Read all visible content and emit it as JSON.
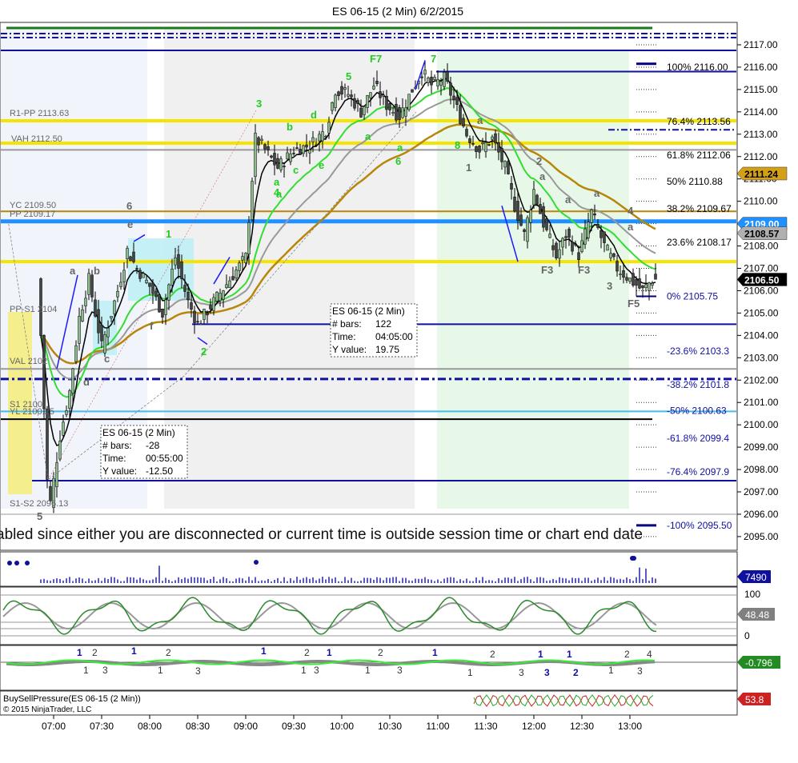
{
  "title": "ES 06-15 (2 Min)  6/2/2015",
  "price_axis_ticks": [
    "2117.00",
    "2116.00",
    "2115.00",
    "2114.00",
    "2113.00",
    "2112.00",
    "2111.00",
    "2110.00",
    "2109.00",
    "2108.00",
    "2107.00",
    "2106.00",
    "2105.00",
    "2104.00",
    "2103.00",
    "2102.00",
    "2101.00",
    "2100.00",
    "2099.00",
    "2098.00",
    "2097.00",
    "2096.00",
    "2095.00"
  ],
  "time_axis_ticks": [
    "07:00",
    "07:30",
    "08:00",
    "08:30",
    "09:00",
    "09:30",
    "10:00",
    "10:30",
    "11:00",
    "11:30",
    "12:00",
    "12:30",
    "13:00"
  ],
  "pivot_labels": {
    "r1pp": "R1-PP 2113.63",
    "vah": "VAH 2112.50",
    "yc": "YC 2109.50",
    "pp": "PP 2109.17",
    "pps1": "PP-S1 2104",
    "val": "VAL 2102",
    "s1": "S1 2100",
    "yl": "YL 2100.25",
    "s1s2": "S1-S2 2096.13"
  },
  "fib_labels": [
    {
      "text": "100%  2116.00",
      "price": 2116.0
    },
    {
      "text": "76.4%  2113.56",
      "price": 2113.56
    },
    {
      "text": "61.8%  2112.06",
      "price": 2112.06
    },
    {
      "text": "50%  2110.88",
      "price": 2110.88
    },
    {
      "text": "38.2%  2109.67",
      "price": 2109.67
    },
    {
      "text": "23.6%  2108.17",
      "price": 2108.17
    },
    {
      "text": "0%  2105.75",
      "price": 2105.75
    },
    {
      "text": "-23.6%  2103.3",
      "price": 2103.3
    },
    {
      "text": "-38.2%  2101.8",
      "price": 2101.8
    },
    {
      "text": "-50%  2100.63",
      "price": 2100.63
    },
    {
      "text": "-61.8%  2099.4",
      "price": 2099.4
    },
    {
      "text": "-76.4%  2097.9",
      "price": 2097.9
    },
    {
      "text": "-100%  2095.50",
      "price": 2095.5
    }
  ],
  "price_badges": [
    {
      "text": "2111.24",
      "price": 2111.24,
      "bg": "#d4a017",
      "fg": "#000000"
    },
    {
      "text": "2109.00",
      "price": 2109.0,
      "bg": "#1e90ff",
      "fg": "#ffffff"
    },
    {
      "text": "2108.57",
      "price": 2108.57,
      "bg": "#b0b0b0",
      "fg": "#000000"
    },
    {
      "text": "2106.50",
      "price": 2106.5,
      "bg": "#000000",
      "fg": "#ffffff"
    }
  ],
  "info_boxes": [
    {
      "title": "ES 06-15 (2 Min)",
      "rows": [
        [
          "# bars:",
          "122"
        ],
        [
          "Time:",
          "04:05:00"
        ],
        [
          "Y value:",
          "19.75"
        ]
      ]
    },
    {
      "title": "ES 06-15 (2 Min)",
      "rows": [
        [
          "# bars:",
          "-28"
        ],
        [
          "Time:",
          "00:55:00"
        ],
        [
          "Y value:",
          "-12.50"
        ]
      ]
    }
  ],
  "banner_text": "abled since either you are disconnected or current time is outside session time or chart end date",
  "wave_labels": [
    {
      "t": "F7",
      "color": "#22cc22"
    },
    {
      "t": "7",
      "color": "#22cc22"
    },
    {
      "t": "5",
      "color": "#22cc22"
    },
    {
      "t": "3",
      "color": "#22cc22"
    },
    {
      "t": "1",
      "color": "#22cc22"
    },
    {
      "t": "2",
      "color": "#22cc22"
    },
    {
      "t": "6",
      "color": "#22cc22"
    },
    {
      "t": "8",
      "color": "#22cc22"
    },
    {
      "t": "a",
      "color": "#22cc22"
    },
    {
      "t": "b",
      "color": "#22cc22"
    },
    {
      "t": "c",
      "color": "#22cc22"
    },
    {
      "t": "d",
      "color": "#22cc22"
    },
    {
      "t": "e",
      "color": "#22cc22"
    },
    {
      "t": "a",
      "color": "#22cc22"
    },
    {
      "t": "a",
      "color": "#22cc22"
    },
    {
      "t": "a",
      "color": "#22cc22"
    },
    {
      "t": "4",
      "color": "#22cc22"
    },
    {
      "t": "6",
      "color": "#666666"
    },
    {
      "t": "a",
      "color": "#666666"
    },
    {
      "t": "b",
      "color": "#666666"
    },
    {
      "t": "c",
      "color": "#666666"
    },
    {
      "t": "d",
      "color": "#666666"
    },
    {
      "t": "e",
      "color": "#666666"
    },
    {
      "t": "f",
      "color": "#666666"
    },
    {
      "t": "5",
      "color": "#666666"
    },
    {
      "t": "2",
      "color": "#666666"
    },
    {
      "t": "a",
      "color": "#666666"
    },
    {
      "t": "a",
      "color": "#666666"
    },
    {
      "t": "a",
      "color": "#666666"
    },
    {
      "t": "a",
      "color": "#666666"
    },
    {
      "t": "a",
      "color": "#666666"
    },
    {
      "t": "F3",
      "color": "#666666"
    },
    {
      "t": "F3",
      "color": "#666666"
    },
    {
      "t": "3",
      "color": "#666666"
    },
    {
      "t": "F5",
      "color": "#666666"
    },
    {
      "t": "4",
      "color": "#666666"
    },
    {
      "t": "1",
      "color": "#666666"
    }
  ],
  "volume_badge": {
    "text": "7490",
    "bg": "#1010a0",
    "fg": "#ffffff"
  },
  "stoch_axis": [
    "100",
    "0"
  ],
  "stoch_badge": {
    "text": "48.48",
    "bg": "#808080",
    "fg": "#ffffff"
  },
  "macd_badge": {
    "text": "-0.796",
    "bg": "#228b22",
    "fg": "#ffffff"
  },
  "macd_labels": [
    {
      "t": "1",
      "color": "#1010a0"
    },
    {
      "t": "2",
      "color": "#333333"
    },
    {
      "t": "1",
      "color": "#333333"
    },
    {
      "t": "3",
      "color": "#333333"
    },
    {
      "t": "1",
      "color": "#1010a0"
    },
    {
      "t": "2",
      "color": "#333333"
    },
    {
      "t": "1",
      "color": "#333333"
    },
    {
      "t": "3",
      "color": "#333333"
    },
    {
      "t": "1",
      "color": "#1010a0"
    },
    {
      "t": "2",
      "color": "#333333"
    },
    {
      "t": "1",
      "color": "#333333"
    },
    {
      "t": "3",
      "color": "#333333"
    },
    {
      "t": "1",
      "color": "#1010a0"
    },
    {
      "t": "2",
      "color": "#333333"
    },
    {
      "t": "1",
      "color": "#333333"
    },
    {
      "t": "3",
      "color": "#333333"
    },
    {
      "t": "1",
      "color": "#1010a0"
    },
    {
      "t": "2",
      "color": "#333333"
    },
    {
      "t": "1",
      "color": "#333333"
    },
    {
      "t": "3",
      "color": "#333333"
    },
    {
      "t": "1",
      "color": "#1010a0"
    },
    {
      "t": "1",
      "color": "#1010a0"
    },
    {
      "t": "3",
      "color": "#1010a0"
    },
    {
      "t": "2",
      "color": "#1010a0"
    },
    {
      "t": "1",
      "color": "#333333"
    },
    {
      "t": "2",
      "color": "#333333"
    },
    {
      "t": "3",
      "color": "#333333"
    },
    {
      "t": "4",
      "color": "#333333"
    }
  ],
  "pressure_label": "BuySellPressure(ES 06-15 (2 Min))",
  "copyright": "© 2015 NinjaTrader, LLC",
  "pressure_badge": {
    "text": "53.8",
    "bg": "#cc2222",
    "fg": "#ffffff"
  },
  "chart_data": {
    "type": "candlestick",
    "title": "ES 06-15 (2 Min)  6/2/2015",
    "ylim": [
      2094.5,
      2117.7
    ],
    "x_range": [
      "06:45",
      "13:20"
    ],
    "ohlc_path": [
      [
        "06:52",
        2104.0
      ],
      [
        "06:56",
        2097.5
      ],
      [
        "06:58",
        2096.5
      ],
      [
        "07:04",
        2099.5
      ],
      [
        "07:10",
        2101.5
      ],
      [
        "07:16",
        2104.8
      ],
      [
        "07:22",
        2106.5
      ],
      [
        "07:30",
        2103.5
      ],
      [
        "07:40",
        2106.0
      ],
      [
        "07:46",
        2107.8
      ],
      [
        "07:52",
        2107.0
      ],
      [
        "08:00",
        2106.2
      ],
      [
        "08:08",
        2105.0
      ],
      [
        "08:16",
        2107.5
      ],
      [
        "08:24",
        2105.5
      ],
      [
        "08:30",
        2104.5
      ],
      [
        "08:40",
        2105.5
      ],
      [
        "08:50",
        2106.5
      ],
      [
        "09:00",
        2107.5
      ],
      [
        "09:06",
        2112.8
      ],
      [
        "09:10",
        2112.5
      ],
      [
        "09:20",
        2111.5
      ],
      [
        "09:30",
        2112.3
      ],
      [
        "09:40",
        2112.5
      ],
      [
        "09:50",
        2113.2
      ],
      [
        "09:56",
        2115.0
      ],
      [
        "10:04",
        2114.8
      ],
      [
        "10:12",
        2114.0
      ],
      [
        "10:20",
        2115.2
      ],
      [
        "10:28",
        2114.3
      ],
      [
        "10:36",
        2113.8
      ],
      [
        "10:44",
        2115.0
      ],
      [
        "10:50",
        2115.8
      ],
      [
        "10:56",
        2115.2
      ],
      [
        "11:04",
        2115.5
      ],
      [
        "11:10",
        2114.5
      ],
      [
        "11:18",
        2113.0
      ],
      [
        "11:26",
        2112.3
      ],
      [
        "11:34",
        2112.8
      ],
      [
        "11:42",
        2111.5
      ],
      [
        "11:48",
        2109.8
      ],
      [
        "11:54",
        2108.5
      ],
      [
        "12:00",
        2110.5
      ],
      [
        "12:06",
        2109.0
      ],
      [
        "12:14",
        2107.5
      ],
      [
        "12:20",
        2108.5
      ],
      [
        "12:28",
        2107.6
      ],
      [
        "12:36",
        2109.5
      ],
      [
        "12:44",
        2108.0
      ],
      [
        "12:52",
        2107.0
      ],
      [
        "13:00",
        2106.5
      ],
      [
        "13:08",
        2106.0
      ],
      [
        "13:14",
        2106.5
      ]
    ],
    "fib_levels": [
      2116.0,
      2113.56,
      2112.06,
      2110.88,
      2109.67,
      2108.17,
      2105.75,
      2103.3,
      2101.8,
      2100.63,
      2099.4,
      2097.9,
      2095.5
    ],
    "annotations": {
      "box1": {
        "bars": 122,
        "time": "04:05:00",
        "y_value": 19.75
      },
      "box2": {
        "bars": -28,
        "time": "00:55:00",
        "y_value": -12.5
      }
    }
  }
}
